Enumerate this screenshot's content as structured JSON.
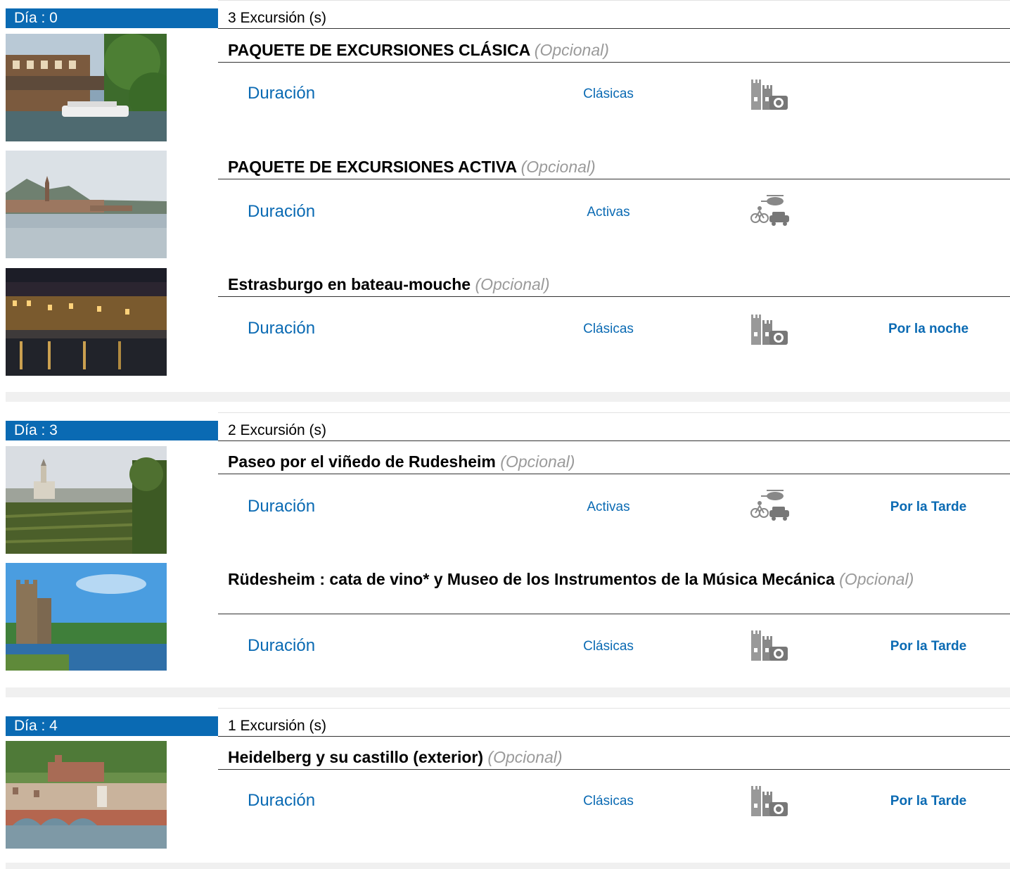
{
  "days": [
    {
      "label": "Día : 0",
      "count": "3 Excursión (s)",
      "excursions": [
        {
          "title": "PAQUETE DE EXCURSIONES CLÁSICA",
          "optional": "(Opcional)",
          "duration_label": "Duración",
          "category": "Clásicas",
          "category_icon": "castle-camera-icon",
          "time": ""
        },
        {
          "title": "PAQUETE DE EXCURSIONES ACTIVA",
          "optional": "(Opcional)",
          "duration_label": "Duración",
          "category": "Activas",
          "category_icon": "bike-helicopter-car-icon",
          "time": ""
        },
        {
          "title": "Estrasburgo en bateau-mouche",
          "optional": "(Opcional)",
          "duration_label": "Duración",
          "category": "Clásicas",
          "category_icon": "castle-camera-icon",
          "time": "Por la noche"
        }
      ]
    },
    {
      "label": "Día : 3",
      "count": "2 Excursión (s)",
      "excursions": [
        {
          "title": "Paseo por el viñedo de Rudesheim",
          "optional": "(Opcional)",
          "duration_label": "Duración",
          "category": "Activas",
          "category_icon": "bike-helicopter-car-icon",
          "time": "Por la Tarde"
        },
        {
          "title": "Rüdesheim : cata de vino* y Museo de los Instrumentos de la Música Mecánica",
          "optional": "(Opcional)",
          "duration_label": "Duración",
          "category": "Clásicas",
          "category_icon": "castle-camera-icon",
          "time": "Por la Tarde"
        }
      ]
    },
    {
      "label": "Día : 4",
      "count": "1 Excursión (s)",
      "excursions": [
        {
          "title": "Heidelberg y su castillo (exterior)",
          "optional": "(Opcional)",
          "duration_label": "Duración",
          "category": "Clásicas",
          "category_icon": "castle-camera-icon",
          "time": "Por la Tarde"
        }
      ]
    }
  ],
  "colors": {
    "accent": "#0a6ab3",
    "optional_text": "#9a9a9a",
    "separator": "#f0f0f0"
  }
}
